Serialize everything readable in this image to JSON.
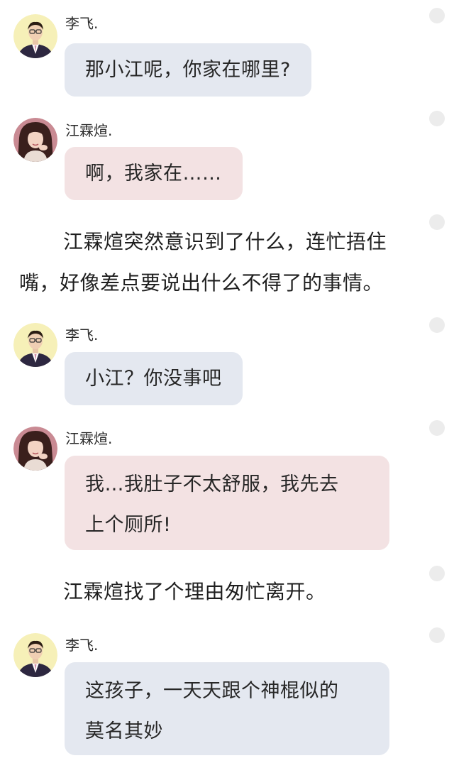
{
  "blocks": [
    {
      "kind": "message",
      "speaker": "lifei",
      "sender": "李飞.",
      "lines": [
        "那小江呢，你家在哪里?"
      ]
    },
    {
      "kind": "message",
      "speaker": "jiang",
      "sender": "江霖煊.",
      "lines": [
        "啊，我家在……"
      ]
    },
    {
      "kind": "narration",
      "lines": [
        "江霖煊突然意识到了什么，连忙捂住",
        "嘴，好像差点要说出什么不得了的事情。"
      ]
    },
    {
      "kind": "message",
      "speaker": "lifei",
      "sender": "李飞.",
      "lines": [
        "小江？你没事吧"
      ]
    },
    {
      "kind": "message",
      "speaker": "jiang",
      "sender": "江霖煊.",
      "lines": [
        "我…我肚子不太舒服，我先去",
        "上个厕所!"
      ]
    },
    {
      "kind": "narration",
      "lines": [
        "江霖煊找了个理由匆忙离开。"
      ]
    },
    {
      "kind": "message",
      "speaker": "lifei",
      "sender": "李飞.",
      "lines": [
        "这孩子，一天天跟个神棍似的",
        "莫名其妙"
      ]
    }
  ],
  "colors": {
    "lifei_bubble": "#e4e8f0",
    "jiang_bubble": "#f3e2e3",
    "side_dot": "#ececec"
  }
}
